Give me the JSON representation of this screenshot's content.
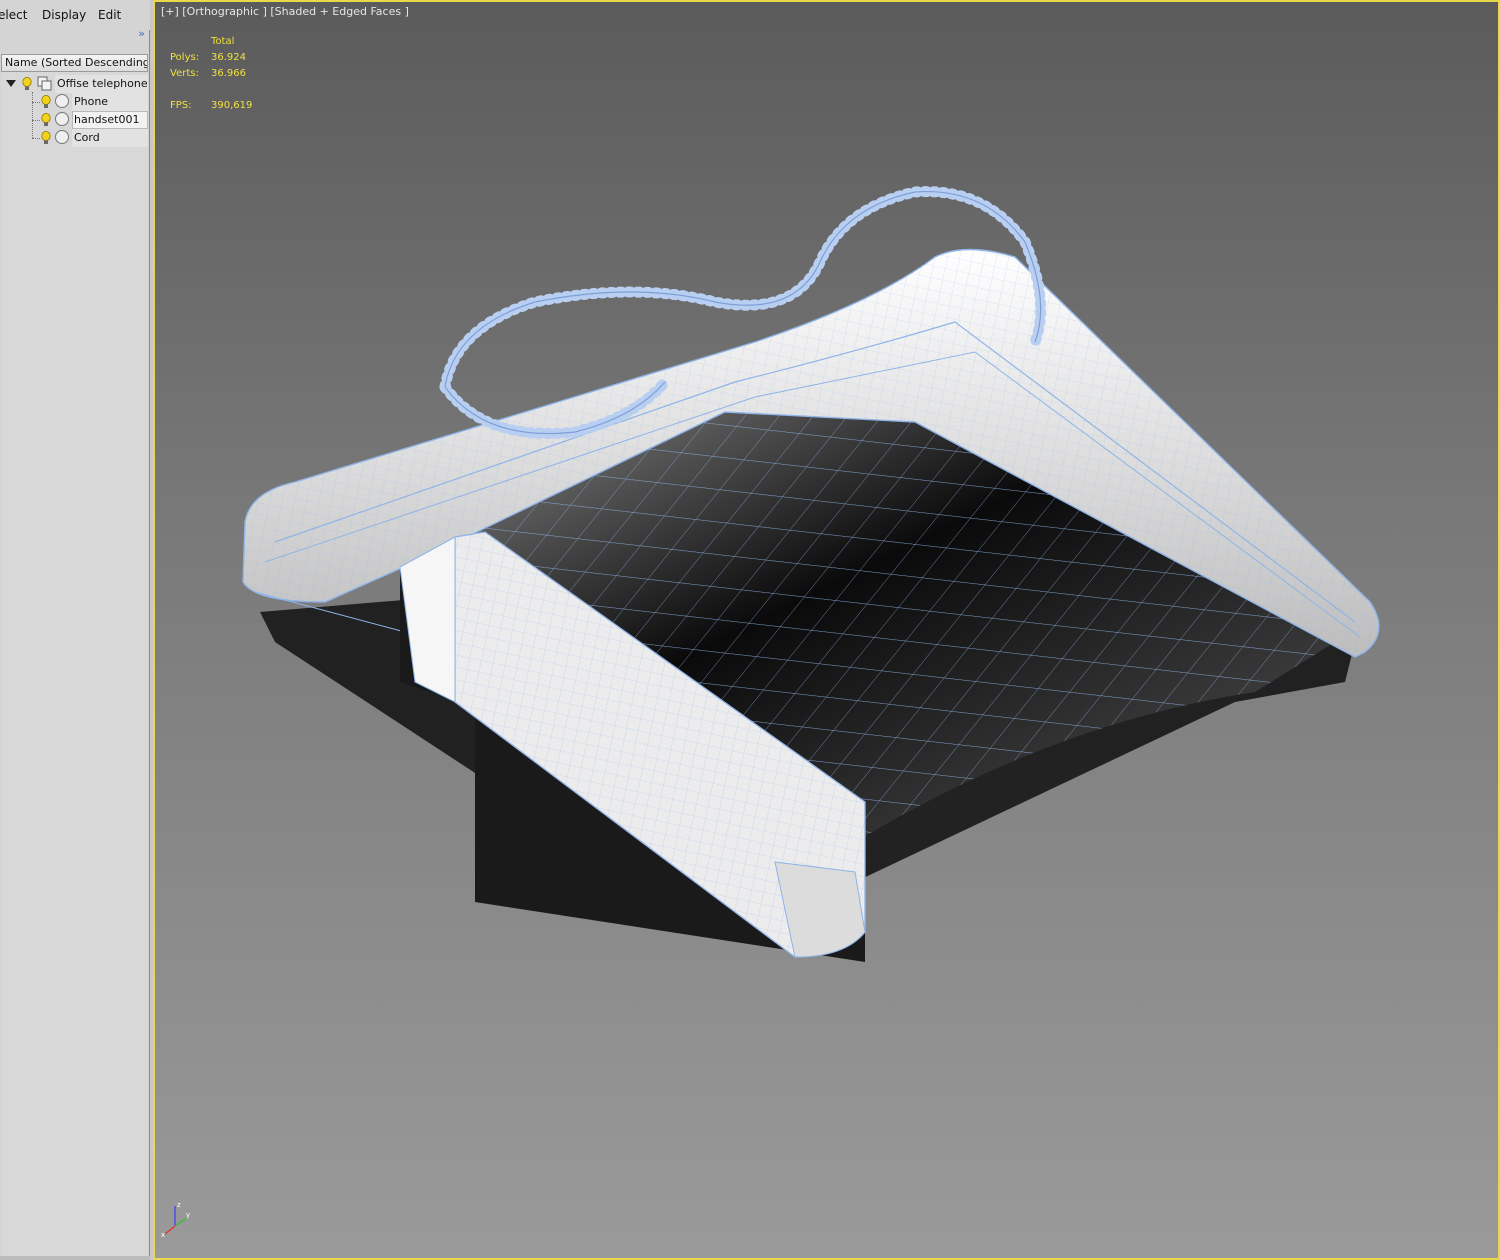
{
  "menu": {
    "items": [
      "elect",
      "Display",
      "Edit"
    ],
    "more": "»"
  },
  "scene_explorer": {
    "column_header": "Name (Sorted Descending)",
    "nodes": [
      {
        "label": "Offise telephone",
        "type": "group",
        "expanded": true
      },
      {
        "label": "Phone",
        "type": "object"
      },
      {
        "label": "handset001",
        "type": "object"
      },
      {
        "label": "Cord",
        "type": "object"
      }
    ]
  },
  "viewport": {
    "label": "[+] [Orthographic ] [Shaded + Edged Faces ]",
    "stats": {
      "header": "Total",
      "polys_label": "Polys:",
      "polys_value": "36.924",
      "verts_label": "Verts:",
      "verts_value": "36.966",
      "fps_label": "FPS:",
      "fps_value": "390,619"
    },
    "gizmo": {
      "z": "z",
      "y": "y",
      "x": "x"
    },
    "colors": {
      "border_active": "#e8d84a",
      "stats_text": "#f0e040",
      "wire": "#8fb4e8",
      "cord": "#b9cff2"
    }
  }
}
